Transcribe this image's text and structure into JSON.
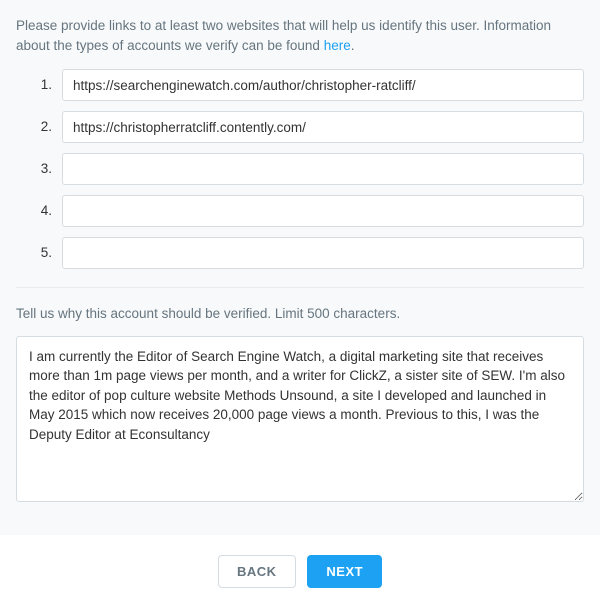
{
  "instructions": {
    "text_before": "Please provide links to at least two websites that will help us identify this user. Information about the types of accounts we verify can be found ",
    "link_text": "here",
    "text_after": "."
  },
  "links": {
    "rows": [
      {
        "num": "1.",
        "value": "https://searchenginewatch.com/author/christopher-ratcliff/"
      },
      {
        "num": "2.",
        "value": "https://christopherratcliff.contently.com/"
      },
      {
        "num": "3.",
        "value": ""
      },
      {
        "num": "4.",
        "value": ""
      },
      {
        "num": "5.",
        "value": ""
      }
    ]
  },
  "why": {
    "label": "Tell us why this account should be verified. Limit 500 characters.",
    "value": "I am currently the Editor of Search Engine Watch, a digital marketing site that receives more than 1m page views per month, and a writer for ClickZ, a sister site of SEW. I'm also the editor of pop culture website Methods Unsound, a site I developed and launched in May 2015 which now receives 20,000 page views a month. Previous to this, I was the Deputy Editor at Econsultancy"
  },
  "footer": {
    "back": "BACK",
    "next": "NEXT"
  }
}
